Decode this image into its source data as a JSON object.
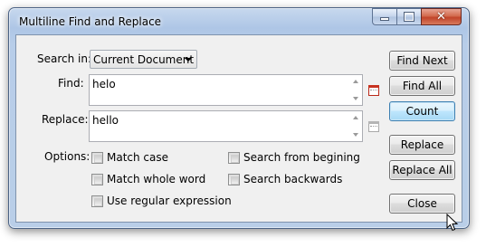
{
  "window": {
    "title": "Multiline Find and Replace"
  },
  "search_in": {
    "label": "Search in:",
    "value": "Current Document"
  },
  "find": {
    "label": "Find:",
    "value": "helo"
  },
  "replace": {
    "label": "Replace:",
    "value": "hello"
  },
  "options": {
    "label": "Options:",
    "match_case": "Match case",
    "match_whole_word": "Match whole word",
    "use_regex": "Use regular expression",
    "search_from_beginning": "Search from begining",
    "search_backwards": "Search backwards"
  },
  "buttons": {
    "find_next": "Find Next",
    "find_all": "Find All",
    "count": "Count",
    "replace": "Replace",
    "replace_all": "Replace All",
    "close": "Close"
  }
}
